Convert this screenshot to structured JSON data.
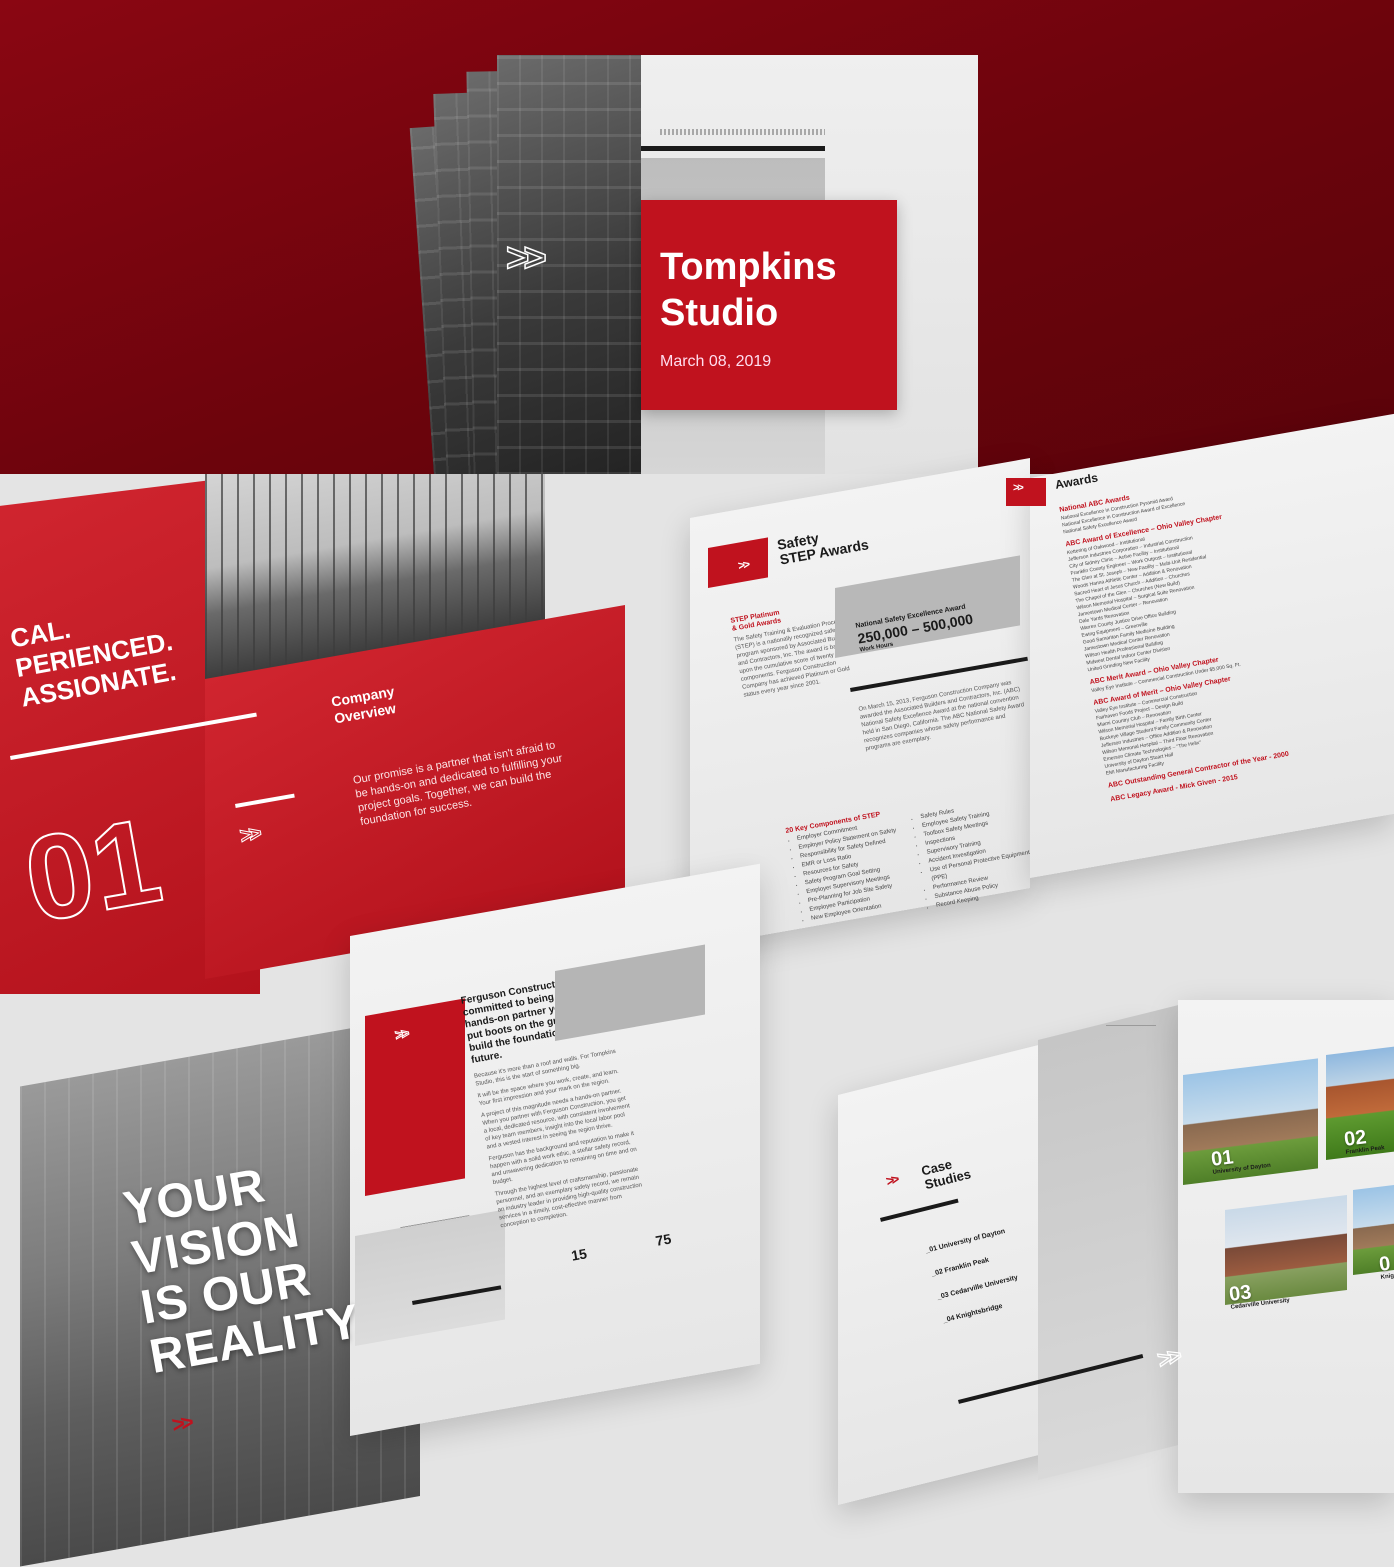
{
  "hero": {
    "title_line1": "Tompkins",
    "title_line2": "Studio",
    "date": "March 08, 2019",
    "chevrons": ">>"
  },
  "overview_spread": {
    "tagline_line1": "CAL.",
    "tagline_line2": "PERIENCED.",
    "tagline_line3": "ASSIONATE.",
    "section_number": "01",
    "heading_line1": "Company",
    "heading_line2": "Overview",
    "body": "Our promise is a partner that isn't afraid to be hands-on and dedicated to fulfilling your project goals. Together, we can build the foundation for success.",
    "chevrons": ">>"
  },
  "safety_spread": {
    "heading_line1": "Safety",
    "heading_line2": "STEP Awards",
    "chevrons": ">>",
    "left_heading_line1": "STEP Platinum",
    "left_heading_line2": "& Gold Awards",
    "left_body": "The Safety Training & Evaluation Process (STEP) is a nationally recognized safety program sponsored by Associated Builders and Contractors, Inc. The award is based upon the cumulative score of twenty key components. Ferguson Construction Company has achieved Platinum or Gold status every year since 2001.",
    "stat_label": "National Safety Excellence Award",
    "stat_value": "250,000 – 500,000",
    "stat_unit": "Work Hours",
    "mid_body": "On March 15, 2013, Ferguson Construction Company was awarded the Associated Builders and Contractors, Inc. (ABC) National Safety Excellence Award at the national convention held in San Diego, California. The ABC National Safety Award recognizes companies whose safety performance and programs are exemplary.",
    "components_heading": "20 Key Components of STEP",
    "components_col1": [
      "Employer Commitment",
      "Employer Policy Statement on Safety",
      "Responsibility for Safety Defined",
      "EMR or Loss Ratio",
      "Resources for Safety",
      "Safety Program Goal Setting",
      "Employer Supervisory Meetings",
      "Pre-Planning for Job Site Safety",
      "Employee Participation",
      "New Employee Orientation"
    ],
    "components_col2": [
      "Safety Rules",
      "Employee Safety Training",
      "Toolbox Safety Meetings",
      "Inspections",
      "Supervisory Training",
      "Accident Investigation",
      "Use of Personal Protective Equipment (PPE)",
      "Performance Review",
      "Substance Abuse Policy",
      "Record Keeping"
    ],
    "awards_heading": "Awards",
    "awards_items": [
      {
        "title": "National ABC Awards",
        "lines": [
          "National Excellence in Construction Pyramid Award",
          "National Excellence in Construction Award of Excellence",
          "National Safety Excellence Award"
        ]
      },
      {
        "title": "ABC Award of Excellence – Ohio Valley Chapter",
        "lines": [
          "Kettering of Oakwood – Institutional",
          "Jefferson Industries Corporation – Industrial Construction",
          "City of Sidney Clinic – Active Facility – Institutional",
          "Franklin County Engineer – Work Outpost – Institutional",
          "The Glen at St. Joseph – New Facility – Multi-Unit Residential",
          "Woods Hanna Athletic Center – Addition & Renovation",
          "Sacred Heart of Jesus Church – Addition – Churches",
          "The Chapel of the Glen – Churches (New Build)",
          "Wilson Memorial Hospital – Surgical Suite Renovation",
          "Jamestown Medical Center – Renovation",
          "Dale Yards Renovation",
          "Warren County Justice Drive Office Building",
          "Ewing Equipment – Greenville",
          "Good Samaritan Family Medicine Building",
          "Jamestown Medical Center Renovation",
          "Wilson Health Professional Building",
          "Midwest Dental Indoor Center Division",
          "United Grinding New Facility"
        ]
      },
      {
        "title": "ABC Merit Award – Ohio Valley Chapter",
        "lines": [
          "Valley Eye Institute – Commercial Construction Under $5,000 Sq. Ft."
        ]
      },
      {
        "title": "ABC Award of Merit – Ohio Valley Chapter",
        "lines": [
          "Valley Eye Institute – Commercial Construction",
          "Fairhaven Foods Project – Design Build",
          "Miami Country Club – Renovation",
          "Wilson Memorial Hospital – Family Birth Center",
          "Buckeye Village Student Family Community Center",
          "Jefferson Industries – Office Addition & Renovation",
          "Wilson Memorial Hospital – Third Floor Renovation",
          "Emerson Climate Technologies – \"The Helix\"",
          "University of Dayton Stuart Hall",
          "EMI Manufacturing Facility"
        ]
      },
      {
        "title": "ABC Outstanding General Contractor of the Year - 2000",
        "lines": []
      },
      {
        "title": "ABC Legacy Award - Mick Given - 2015",
        "lines": []
      }
    ]
  },
  "vision_spread": {
    "line1": "YOUR",
    "line2": "VISION",
    "line3": "IS OUR",
    "line4": "REALITY.",
    "chevrons": ">>",
    "heading": "Ferguson Construction is committed to being the local, hands-on partner you need to put boots on the ground and build the foundation of your future.",
    "para1": "Because it's more than a roof and walls. For Tompkins Studio, this is the start of something big.",
    "para2": "It will be the space where you work, create, and learn. Your first impression and your mark on the region.",
    "para3": "A project of this magnitude needs a hands-on partner. When you partner with Ferguson Construction, you get a local, dedicated resource, with consistent involvement of key team members, insight into the local labor pool and a vested interest in seeing the region thrive.",
    "para4": "Ferguson has the background and reputation to make it happen with a solid work ethic, a stellar safety record, and unwavering dedication to remaining on time and on budget.",
    "para5": "Through the highest level of craftsmanship, passionate personnel, and an exemplary safety record, we remain an industry leader in providing high-quality construction services in a timely, cost-effective manner from conception to completion.",
    "stat1": "15",
    "stat2": "75"
  },
  "case_spread": {
    "heading_line1": "Case",
    "heading_line2": "Studies",
    "chevrons": ">>",
    "list": [
      "_01  University of Dayton",
      "_02  Franklin Peak",
      "_03  Cedarville University",
      "_04  Knightsbridge"
    ],
    "photos": [
      {
        "number": "01",
        "label": "University of Dayton"
      },
      {
        "number": "02",
        "label": "Franklin Peak"
      },
      {
        "number": "03",
        "label": "Cedarville University"
      },
      {
        "number": "0",
        "label": "Knig"
      }
    ]
  },
  "colors": {
    "brand_red": "#c0121e",
    "hero_bg": "#7a0510",
    "page_bg": "#e4e4e4"
  }
}
